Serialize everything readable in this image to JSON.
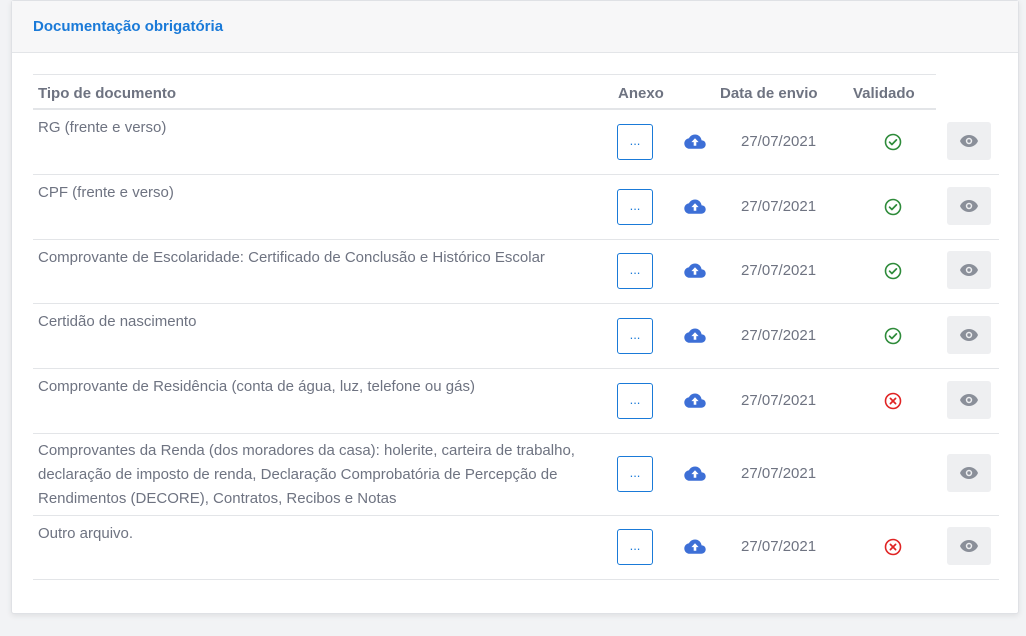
{
  "header": {
    "title": "Documentação obrigatória"
  },
  "table": {
    "columns": {
      "type": "Tipo de documento",
      "attachment": "Anexo",
      "date": "Data de envio",
      "validated": "Validado"
    },
    "attach_button_label": "...",
    "rows": [
      {
        "name": "RG (frente e verso)",
        "date": "27/07/2021",
        "validated": "yes"
      },
      {
        "name": "CPF (frente e verso)",
        "date": "27/07/2021",
        "validated": "yes"
      },
      {
        "name": "Comprovante de Escolaridade: Certificado de Conclusão e Histórico Escolar",
        "date": "27/07/2021",
        "validated": "yes"
      },
      {
        "name": "Certidão de nascimento",
        "date": "27/07/2021",
        "validated": "yes"
      },
      {
        "name": "Comprovante de Residência (conta de água, luz, telefone ou gás)",
        "date": "27/07/2021",
        "validated": "no"
      },
      {
        "name": "Comprovantes da Renda (dos moradores da casa): holerite, carteira de trabalho, declaração de imposto de renda, Declaração Comprobatória de Percepção de Rendimentos (DECORE), Contratos, Recibos e Notas",
        "date": "27/07/2021",
        "validated": "none"
      },
      {
        "name": "Outro arquivo.",
        "date": "27/07/2021",
        "validated": "no"
      }
    ]
  },
  "colors": {
    "accent": "#1a7ad8",
    "upload_icon": "#3d6fd6",
    "valid": "#2e8b3a",
    "invalid": "#e02424",
    "text": "#6e7381"
  },
  "icons": {
    "upload": "cloud-upload-icon",
    "valid": "check-circle-icon",
    "invalid": "x-circle-icon",
    "view": "eye-icon"
  }
}
